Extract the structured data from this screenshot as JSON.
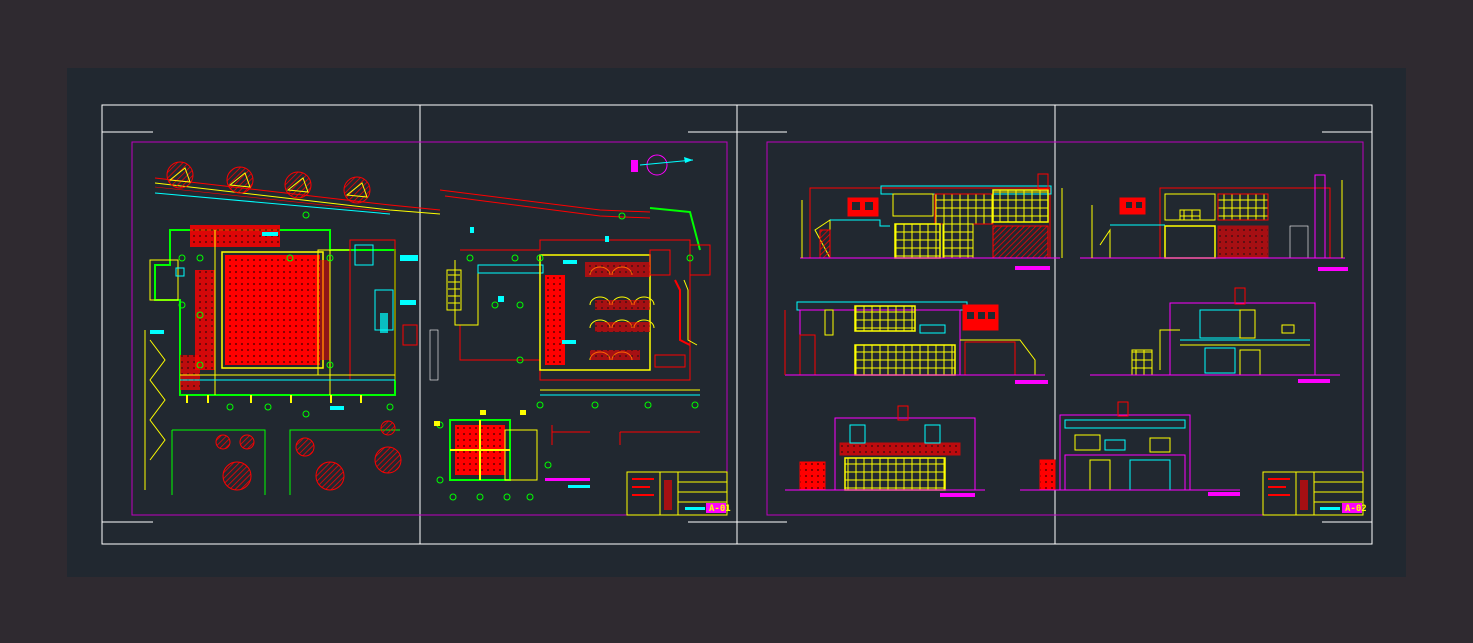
{
  "colors": {
    "outer_background": "#2f2a30",
    "model_space": "#212830",
    "frame_white": "#ffffff",
    "sheet_border_magenta": "#c000c0",
    "wall_red": "#ff0000",
    "wall_yellow": "#ffff00",
    "dim_cyan": "#00ffff",
    "grid_green": "#00ff00",
    "title_magenta": "#ff00ff"
  },
  "sheets": [
    {
      "sheet_number": "A-01"
    },
    {
      "sheet_number": "A-02"
    }
  ]
}
